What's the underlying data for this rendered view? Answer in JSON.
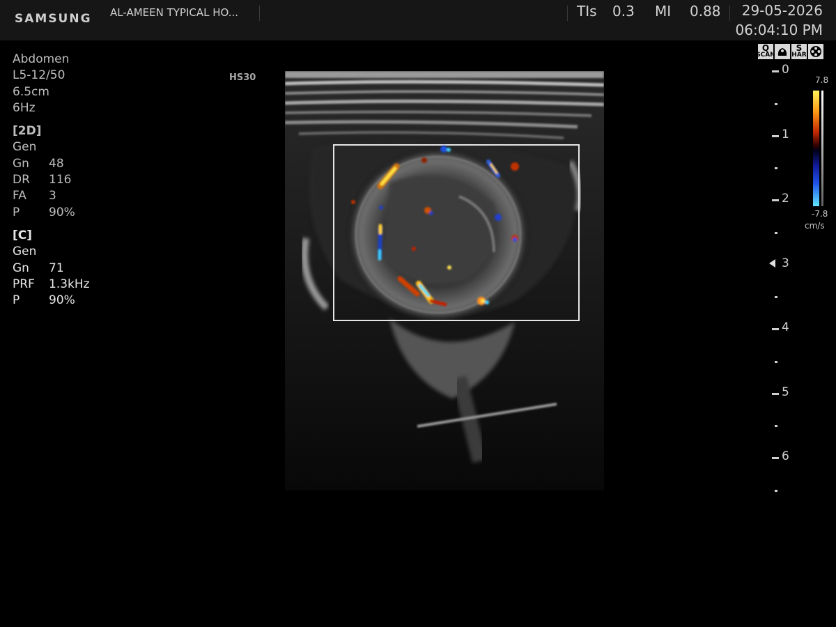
{
  "header": {
    "brand": "SAMSUNG",
    "hospital": "AL-AMEEN TYPICAL HO...",
    "tis_label": "TIs",
    "tis_value": "0.3",
    "mi_label": "MI",
    "mi_value": "0.88",
    "date": "29-05-2026",
    "time": "06:04:10 PM"
  },
  "params": {
    "preset": "Abdomen",
    "probe": "L5-12/50",
    "depth": "6.5cm",
    "frame_rate": "6Hz",
    "mode_2d": {
      "title": "[2D]",
      "map": "Gen",
      "rows": [
        {
          "k": "Gn",
          "v": "48"
        },
        {
          "k": "DR",
          "v": "116"
        },
        {
          "k": "FA",
          "v": "3"
        },
        {
          "k": "P",
          "v": "90%"
        }
      ]
    },
    "mode_c": {
      "title": "[C]",
      "map": "Gen",
      "rows": [
        {
          "k": "Gn",
          "v": "71"
        },
        {
          "k": "PRF",
          "v": "1.3kHz"
        },
        {
          "k": "P",
          "v": "90%"
        }
      ]
    }
  },
  "image": {
    "hs_label": "HS30"
  },
  "icons": [
    {
      "name": "qscan-icon",
      "top": "Q",
      "bottom": "SCAN"
    },
    {
      "name": "probe-icon",
      "top": "",
      "bottom": ""
    },
    {
      "name": "harmonic-icon",
      "top": "S",
      "bottom": "HAR"
    },
    {
      "name": "film-reel-icon",
      "top": "",
      "bottom": ""
    }
  ],
  "depth_scale": {
    "labels": [
      "0",
      "1",
      "2",
      "3",
      "4",
      "5",
      "6"
    ],
    "focus_marker": "focus-arrow-icon"
  },
  "color_bar": {
    "max": "7.8",
    "min": "-7.8",
    "unit": "cm/s"
  }
}
